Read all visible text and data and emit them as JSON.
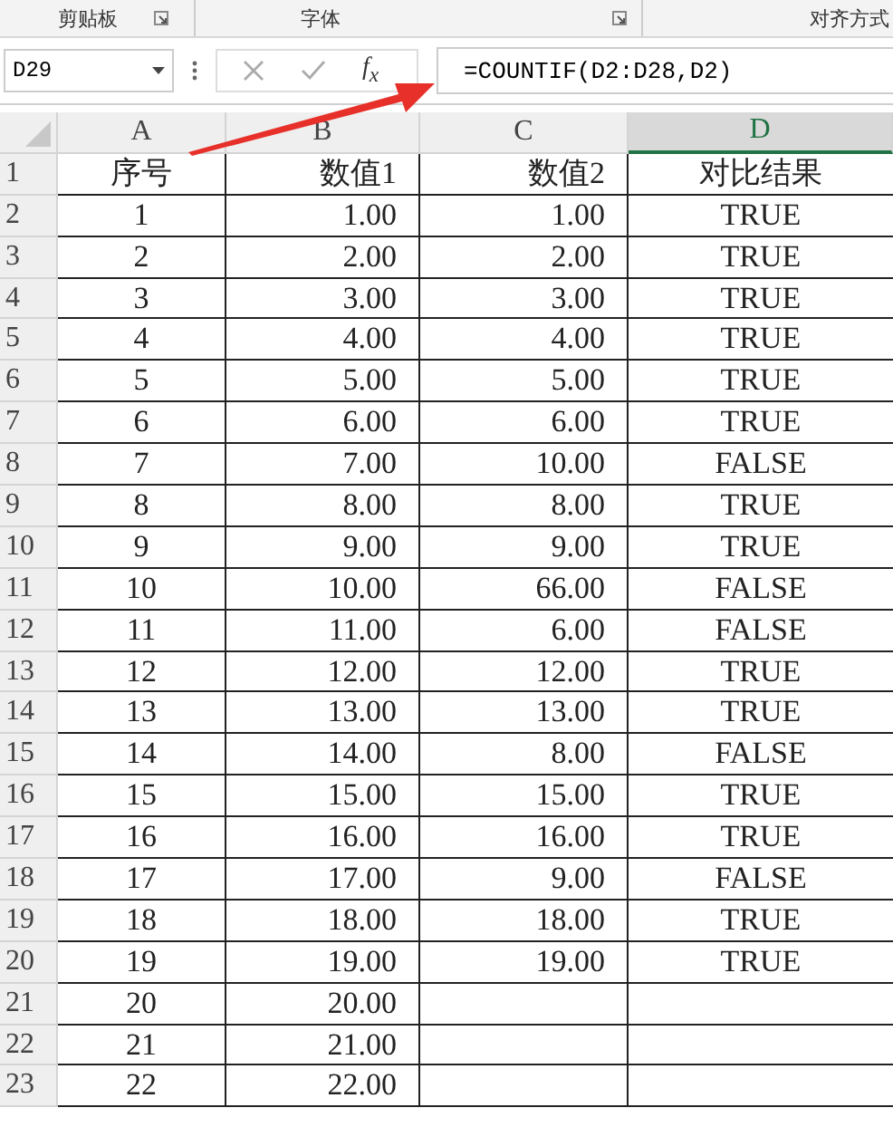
{
  "ribbon_groups": [
    {
      "label": "剪贴板",
      "launcher": true
    },
    {
      "label": "字体",
      "launcher": true
    },
    {
      "label": "对齐方式",
      "launcher": false
    }
  ],
  "formula_bar": {
    "name_box": "D29",
    "function_label": "f$_{x}$",
    "formula": "=COUNTIF(D2:D28,D2)"
  },
  "columns": [
    {
      "label": "A",
      "selected": false
    },
    {
      "label": "B",
      "selected": false
    },
    {
      "label": "C",
      "selected": false
    },
    {
      "label": "D",
      "selected": true
    }
  ],
  "rows": [
    {
      "header": "1",
      "cells": [
        "序号",
        "数值1",
        "数值2",
        "对比结果"
      ]
    },
    {
      "header": "2",
      "cells": [
        "1",
        "1.00",
        "1.00",
        "TRUE"
      ]
    },
    {
      "header": "3",
      "cells": [
        "2",
        "2.00",
        "2.00",
        "TRUE"
      ]
    },
    {
      "header": "4",
      "cells": [
        "3",
        "3.00",
        "3.00",
        "TRUE"
      ]
    },
    {
      "header": "5",
      "cells": [
        "4",
        "4.00",
        "4.00",
        "TRUE"
      ]
    },
    {
      "header": "6",
      "cells": [
        "5",
        "5.00",
        "5.00",
        "TRUE"
      ]
    },
    {
      "header": "7",
      "cells": [
        "6",
        "6.00",
        "6.00",
        "TRUE"
      ]
    },
    {
      "header": "8",
      "cells": [
        "7",
        "7.00",
        "10.00",
        "FALSE"
      ]
    },
    {
      "header": "9",
      "cells": [
        "8",
        "8.00",
        "8.00",
        "TRUE"
      ]
    },
    {
      "header": "10",
      "cells": [
        "9",
        "9.00",
        "9.00",
        "TRUE"
      ]
    },
    {
      "header": "11",
      "cells": [
        "10",
        "10.00",
        "66.00",
        "FALSE"
      ]
    },
    {
      "header": "12",
      "cells": [
        "11",
        "11.00",
        "6.00",
        "FALSE"
      ]
    },
    {
      "header": "13",
      "cells": [
        "12",
        "12.00",
        "12.00",
        "TRUE"
      ]
    },
    {
      "header": "14",
      "cells": [
        "13",
        "13.00",
        "13.00",
        "TRUE"
      ]
    },
    {
      "header": "15",
      "cells": [
        "14",
        "14.00",
        "8.00",
        "FALSE"
      ]
    },
    {
      "header": "16",
      "cells": [
        "15",
        "15.00",
        "15.00",
        "TRUE"
      ]
    },
    {
      "header": "17",
      "cells": [
        "16",
        "16.00",
        "16.00",
        "TRUE"
      ]
    },
    {
      "header": "18",
      "cells": [
        "17",
        "17.00",
        "9.00",
        "FALSE"
      ]
    },
    {
      "header": "19",
      "cells": [
        "18",
        "18.00",
        "18.00",
        "TRUE"
      ]
    },
    {
      "header": "20",
      "cells": [
        "19",
        "19.00",
        "19.00",
        "TRUE"
      ]
    },
    {
      "header": "21",
      "cells": [
        "20",
        "20.00"
      ]
    },
    {
      "header": "22",
      "cells": [
        "21",
        "21.00"
      ]
    },
    {
      "header": "23",
      "cells": [
        "22",
        "22.00"
      ]
    }
  ]
}
